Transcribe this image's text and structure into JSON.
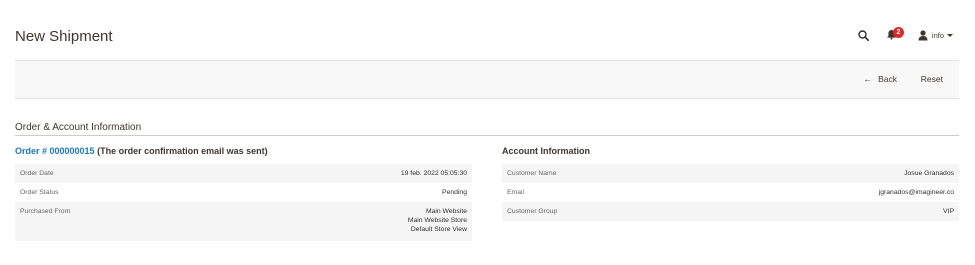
{
  "header": {
    "title": "New Shipment",
    "notification_count": "2",
    "user_name": "info"
  },
  "action_bar": {
    "back_label": "Back",
    "back_icon": "←",
    "reset_label": "Reset"
  },
  "section": {
    "title": "Order & Account Information"
  },
  "order": {
    "link_text": "Order # 000000015",
    "note": " (The order confirmation email was sent)",
    "rows": [
      {
        "label": "Order Date",
        "value": "19 feb. 2022 05:05:30"
      },
      {
        "label": "Order Status",
        "value": "Pending"
      },
      {
        "label": "Purchased From",
        "value_lines": [
          "Main Website",
          "Main Website Store",
          "Default Store View"
        ]
      }
    ]
  },
  "account": {
    "title": "Account Information",
    "rows": [
      {
        "label": "Customer Name",
        "value": "Josue Granados"
      },
      {
        "label": "Email",
        "value": "jgranados@imagineer.co"
      },
      {
        "label": "Customer Group",
        "value": "VIP"
      }
    ]
  },
  "icons": {
    "search": "search-icon",
    "notifications": "bell-icon",
    "user": "user-icon",
    "back": "arrow-left-icon"
  },
  "colors": {
    "link": "#1979c3",
    "badge": "#e22626",
    "text": "#41362f"
  }
}
